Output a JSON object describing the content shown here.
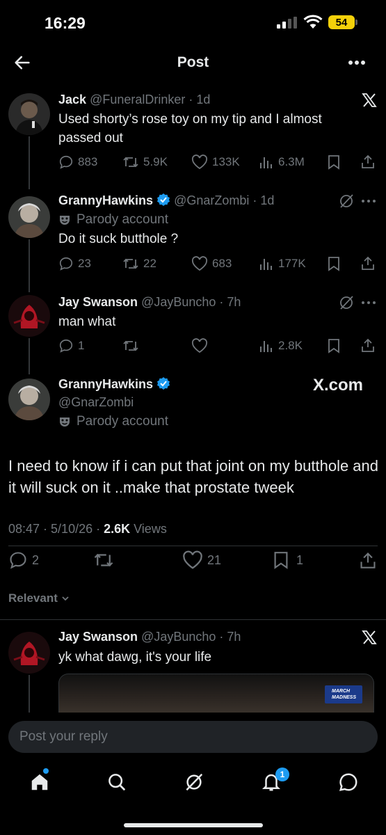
{
  "status_bar": {
    "time": "16:29",
    "battery": "54"
  },
  "header": {
    "title": "Post"
  },
  "tweets": [
    {
      "name": "Jack",
      "handle": "@FuneralDrinker",
      "time": "· 1d",
      "text": "Used shorty’s rose toy on my tip and I almost passed out",
      "replies": "883",
      "reposts": "5.9K",
      "likes": "133K",
      "views": "6.3M"
    },
    {
      "name": "GrannyHawkins",
      "handle": "@GnarZombi",
      "time": "· 1d",
      "label": "Parody account",
      "text": "Do it suck butthole ?",
      "replies": "23",
      "reposts": "22",
      "likes": "683",
      "views": "177K"
    },
    {
      "name": "Jay Swanson",
      "handle": "@JayBuncho",
      "time": "· 7h",
      "text": "man what",
      "replies": "1",
      "reposts": "",
      "likes": "",
      "views": "2.8K"
    }
  ],
  "main_post": {
    "name": "GrannyHawkins",
    "handle": "@GnarZombi",
    "label": "Parody account",
    "watermark": "X.com",
    "text": "I need to know if i can put that joint on my butthole and it will suck on it ..make that prostate tweek",
    "timestamp": "08:47 · 5/10/26 · ",
    "views_count": "2.6K",
    "views_label": " Views",
    "replies": "2",
    "reposts": "",
    "likes": "21",
    "bookmarks": "1"
  },
  "sort": {
    "label": "Relevant"
  },
  "reply_tweet": {
    "name": "Jay Swanson",
    "handle": "@JayBuncho",
    "time": "· 7h",
    "text": "yk what dawg, it's your life",
    "media_badge": "MARCH MADNESS"
  },
  "reply_input": {
    "placeholder": "Post your reply"
  },
  "nav": {
    "notifications_count": "1"
  },
  "colors": {
    "background": "#000000",
    "text": "#e7e9ea",
    "muted": "#71767b",
    "verified": "#1d9bf0"
  },
  "icons": [
    "back-arrow-icon",
    "more-icon",
    "x-logo-icon",
    "reply-icon",
    "repost-icon",
    "like-icon",
    "views-icon",
    "bookmark-icon",
    "share-icon",
    "grok-icon",
    "verified-icon",
    "parody-mask-icon",
    "home-icon",
    "search-icon",
    "bell-icon",
    "messages-icon"
  ]
}
